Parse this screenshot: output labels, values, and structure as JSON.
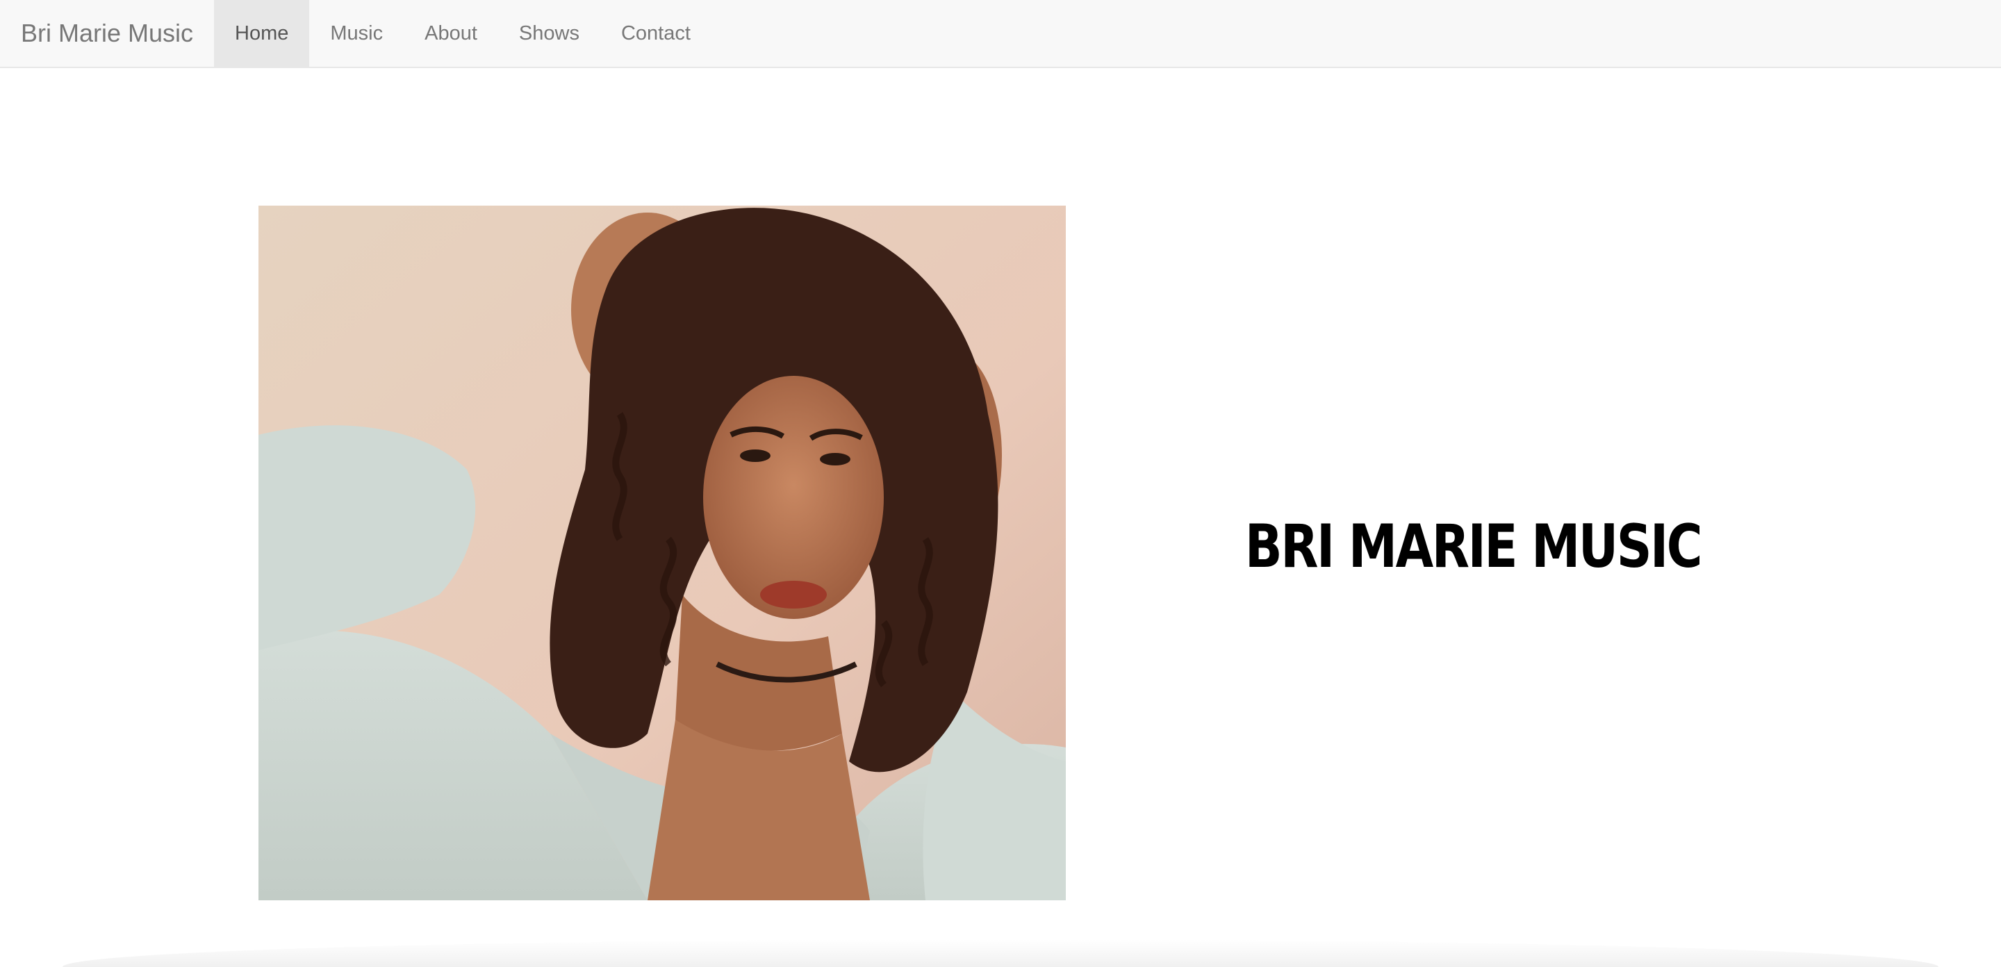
{
  "navbar": {
    "brand": "Bri Marie Music",
    "items": [
      {
        "label": "Home",
        "active": true
      },
      {
        "label": "Music",
        "active": false
      },
      {
        "label": "About",
        "active": false
      },
      {
        "label": "Shows",
        "active": false
      },
      {
        "label": "Contact",
        "active": false
      }
    ]
  },
  "hero": {
    "title": "BRI MARIE MUSIC",
    "photo_subject": "portrait-photo"
  },
  "colors": {
    "navbar_bg": "#f8f8f8",
    "active_item_bg": "#e7e7e7",
    "nav_text": "#777777",
    "title_text": "#000000"
  }
}
